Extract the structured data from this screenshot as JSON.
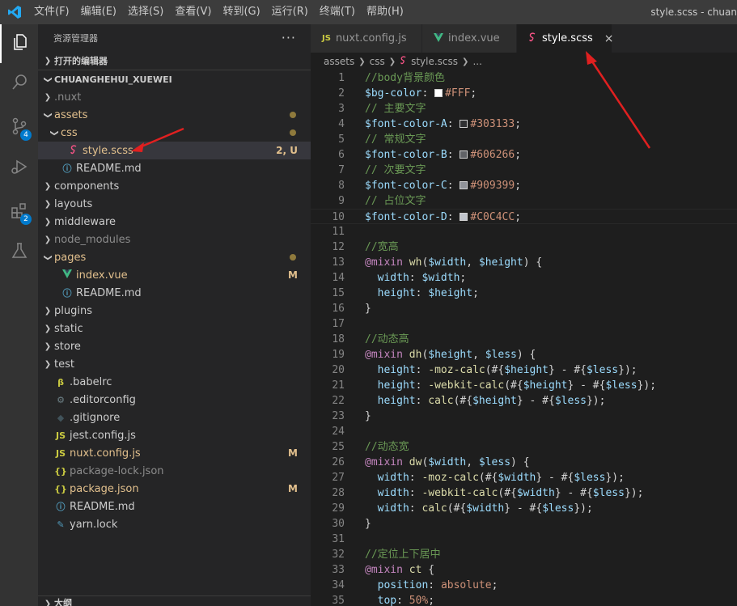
{
  "titlebar": {
    "menus": [
      "文件(F)",
      "编辑(E)",
      "选择(S)",
      "查看(V)",
      "转到(G)",
      "运行(R)",
      "终端(T)",
      "帮助(H)"
    ],
    "window_title": "style.scss - chuan"
  },
  "activity": {
    "scm_badge": "4",
    "ext_badge": "2"
  },
  "sidebar": {
    "title": "资源管理器",
    "more": "···",
    "open_editors": "打开的编辑器",
    "workspace": "CHUANGHEHUI_XUEWEI",
    "outline": "大纲",
    "tree": [
      {
        "label": ".nuxt",
        "kind": "folder",
        "state": "closed",
        "depth": 1,
        "muted": true
      },
      {
        "label": "assets",
        "kind": "folder",
        "state": "open",
        "depth": 1,
        "mod": true,
        "dot": true
      },
      {
        "label": "css",
        "kind": "folder",
        "state": "open",
        "depth": 2,
        "mod": true,
        "dot": true
      },
      {
        "label": "style.scss",
        "kind": "scss",
        "depth": 3,
        "mod": true,
        "status": "2, U",
        "selected": true
      },
      {
        "label": "README.md",
        "kind": "info",
        "depth": 2
      },
      {
        "label": "components",
        "kind": "folder",
        "state": "closed",
        "depth": 1
      },
      {
        "label": "layouts",
        "kind": "folder",
        "state": "closed",
        "depth": 1
      },
      {
        "label": "middleware",
        "kind": "folder",
        "state": "closed",
        "depth": 1
      },
      {
        "label": "node_modules",
        "kind": "folder",
        "state": "closed",
        "depth": 1,
        "muted": true
      },
      {
        "label": "pages",
        "kind": "folder",
        "state": "open",
        "depth": 1,
        "mod": true,
        "dot": true
      },
      {
        "label": "index.vue",
        "kind": "vue",
        "depth": 2,
        "mod": true,
        "status": "M"
      },
      {
        "label": "README.md",
        "kind": "info",
        "depth": 2
      },
      {
        "label": "plugins",
        "kind": "folder",
        "state": "closed",
        "depth": 1
      },
      {
        "label": "static",
        "kind": "folder",
        "state": "closed",
        "depth": 1
      },
      {
        "label": "store",
        "kind": "folder",
        "state": "closed",
        "depth": 1
      },
      {
        "label": "test",
        "kind": "folder",
        "state": "closed",
        "depth": 1
      },
      {
        "label": ".babelrc",
        "kind": "babel",
        "depth": 1
      },
      {
        "label": ".editorconfig",
        "kind": "gear",
        "depth": 1
      },
      {
        "label": ".gitignore",
        "kind": "git",
        "depth": 1
      },
      {
        "label": "jest.config.js",
        "kind": "js",
        "depth": 1
      },
      {
        "label": "nuxt.config.js",
        "kind": "js",
        "depth": 1,
        "mod": true,
        "status": "M"
      },
      {
        "label": "package-lock.json",
        "kind": "json",
        "depth": 1,
        "muted": true
      },
      {
        "label": "package.json",
        "kind": "json",
        "depth": 1,
        "mod": true,
        "status": "M"
      },
      {
        "label": "README.md",
        "kind": "info",
        "depth": 1
      },
      {
        "label": "yarn.lock",
        "kind": "yarn",
        "depth": 1
      }
    ]
  },
  "tabs": [
    {
      "label": "nuxt.config.js",
      "icon": "JS",
      "kind": "js",
      "active": false
    },
    {
      "label": "index.vue",
      "icon": "V",
      "kind": "vue",
      "active": false
    },
    {
      "label": "style.scss",
      "icon": "sass",
      "kind": "scss",
      "active": true,
      "close": "×"
    }
  ],
  "breadcrumb": [
    "assets",
    "css",
    "style.scss",
    "..."
  ],
  "colors": {
    "bg": "#FFF",
    "A": "#303133",
    "B": "#606266",
    "C": "#909399",
    "D": "#C0C4CC",
    "accent": "#007acc",
    "arrow": "#e02020"
  },
  "code": [
    [
      {
        "t": "//body背景颜色",
        "c": "cmt"
      }
    ],
    [
      {
        "t": "$bg-color",
        "c": "var"
      },
      {
        "t": ": ",
        "c": "p"
      },
      {
        "t": "#FFF",
        "c": "num",
        "sw": "#FFFFFF"
      },
      {
        "t": ";",
        "c": "p"
      }
    ],
    [
      {
        "t": "// 主要文字",
        "c": "cmt"
      }
    ],
    [
      {
        "t": "$font-color-A",
        "c": "var"
      },
      {
        "t": ": ",
        "c": "p"
      },
      {
        "t": "#303133",
        "c": "num",
        "sw": "#303133"
      },
      {
        "t": ";",
        "c": "p"
      }
    ],
    [
      {
        "t": "// 常规文字",
        "c": "cmt"
      }
    ],
    [
      {
        "t": "$font-color-B",
        "c": "var"
      },
      {
        "t": ": ",
        "c": "p"
      },
      {
        "t": "#606266",
        "c": "num",
        "sw": "#606266"
      },
      {
        "t": ";",
        "c": "p"
      }
    ],
    [
      {
        "t": "// 次要文字",
        "c": "cmt"
      }
    ],
    [
      {
        "t": "$font-color-C",
        "c": "var"
      },
      {
        "t": ": ",
        "c": "p"
      },
      {
        "t": "#909399",
        "c": "num",
        "sw": "#909399"
      },
      {
        "t": ";",
        "c": "p"
      }
    ],
    [
      {
        "t": "// 占位文字",
        "c": "cmt"
      }
    ],
    [
      {
        "t": "$font-color-D",
        "c": "var"
      },
      {
        "t": ": ",
        "c": "p"
      },
      {
        "t": "#C0C4CC",
        "c": "num",
        "sw": "#C0C4CC"
      },
      {
        "t": ";",
        "c": "p"
      }
    ],
    [],
    [
      {
        "t": "//宽高",
        "c": "cmt"
      }
    ],
    [
      {
        "t": "@mixin",
        "c": "kw"
      },
      {
        "t": " ",
        "c": "p"
      },
      {
        "t": "wh",
        "c": "fn"
      },
      {
        "t": "(",
        "c": "p"
      },
      {
        "t": "$width",
        "c": "var"
      },
      {
        "t": ", ",
        "c": "p"
      },
      {
        "t": "$height",
        "c": "var"
      },
      {
        "t": ") {",
        "c": "p"
      }
    ],
    [
      {
        "t": "  width",
        "c": "var"
      },
      {
        "t": ": ",
        "c": "p"
      },
      {
        "t": "$width",
        "c": "var"
      },
      {
        "t": ";",
        "c": "p"
      }
    ],
    [
      {
        "t": "  height",
        "c": "var"
      },
      {
        "t": ": ",
        "c": "p"
      },
      {
        "t": "$height",
        "c": "var"
      },
      {
        "t": ";",
        "c": "p"
      }
    ],
    [
      {
        "t": "}",
        "c": "p"
      }
    ],
    [],
    [
      {
        "t": "//动态高",
        "c": "cmt"
      }
    ],
    [
      {
        "t": "@mixin",
        "c": "kw"
      },
      {
        "t": " ",
        "c": "p"
      },
      {
        "t": "dh",
        "c": "fn"
      },
      {
        "t": "(",
        "c": "p"
      },
      {
        "t": "$height",
        "c": "var"
      },
      {
        "t": ", ",
        "c": "p"
      },
      {
        "t": "$less",
        "c": "var"
      },
      {
        "t": ") {",
        "c": "p"
      }
    ],
    [
      {
        "t": "  height",
        "c": "var"
      },
      {
        "t": ": ",
        "c": "p"
      },
      {
        "t": "-moz-calc",
        "c": "fn"
      },
      {
        "t": "(#{",
        "c": "p"
      },
      {
        "t": "$height",
        "c": "var"
      },
      {
        "t": "} - #{",
        "c": "p"
      },
      {
        "t": "$less",
        "c": "var"
      },
      {
        "t": "});",
        "c": "p"
      }
    ],
    [
      {
        "t": "  height",
        "c": "var"
      },
      {
        "t": ": ",
        "c": "p"
      },
      {
        "t": "-webkit-calc",
        "c": "fn"
      },
      {
        "t": "(#{",
        "c": "p"
      },
      {
        "t": "$height",
        "c": "var"
      },
      {
        "t": "} - #{",
        "c": "p"
      },
      {
        "t": "$less",
        "c": "var"
      },
      {
        "t": "});",
        "c": "p"
      }
    ],
    [
      {
        "t": "  height",
        "c": "var"
      },
      {
        "t": ": ",
        "c": "p"
      },
      {
        "t": "calc",
        "c": "fn"
      },
      {
        "t": "(#{",
        "c": "p"
      },
      {
        "t": "$height",
        "c": "var"
      },
      {
        "t": "} - #{",
        "c": "p"
      },
      {
        "t": "$less",
        "c": "var"
      },
      {
        "t": "});",
        "c": "p"
      }
    ],
    [
      {
        "t": "}",
        "c": "p"
      }
    ],
    [],
    [
      {
        "t": "//动态宽",
        "c": "cmt"
      }
    ],
    [
      {
        "t": "@mixin",
        "c": "kw"
      },
      {
        "t": " ",
        "c": "p"
      },
      {
        "t": "dw",
        "c": "fn"
      },
      {
        "t": "(",
        "c": "p"
      },
      {
        "t": "$width",
        "c": "var"
      },
      {
        "t": ", ",
        "c": "p"
      },
      {
        "t": "$less",
        "c": "var"
      },
      {
        "t": ") {",
        "c": "p"
      }
    ],
    [
      {
        "t": "  width",
        "c": "var"
      },
      {
        "t": ": ",
        "c": "p"
      },
      {
        "t": "-moz-calc",
        "c": "fn"
      },
      {
        "t": "(#{",
        "c": "p"
      },
      {
        "t": "$width",
        "c": "var"
      },
      {
        "t": "} - #{",
        "c": "p"
      },
      {
        "t": "$less",
        "c": "var"
      },
      {
        "t": "});",
        "c": "p"
      }
    ],
    [
      {
        "t": "  width",
        "c": "var"
      },
      {
        "t": ": ",
        "c": "p"
      },
      {
        "t": "-webkit-calc",
        "c": "fn"
      },
      {
        "t": "(#{",
        "c": "p"
      },
      {
        "t": "$width",
        "c": "var"
      },
      {
        "t": "} - #{",
        "c": "p"
      },
      {
        "t": "$less",
        "c": "var"
      },
      {
        "t": "});",
        "c": "p"
      }
    ],
    [
      {
        "t": "  width",
        "c": "var"
      },
      {
        "t": ": ",
        "c": "p"
      },
      {
        "t": "calc",
        "c": "fn"
      },
      {
        "t": "(#{",
        "c": "p"
      },
      {
        "t": "$width",
        "c": "var"
      },
      {
        "t": "} - #{",
        "c": "p"
      },
      {
        "t": "$less",
        "c": "var"
      },
      {
        "t": "});",
        "c": "p"
      }
    ],
    [
      {
        "t": "}",
        "c": "p"
      }
    ],
    [],
    [
      {
        "t": "//定位上下居中",
        "c": "cmt"
      }
    ],
    [
      {
        "t": "@mixin",
        "c": "kw"
      },
      {
        "t": " ",
        "c": "p"
      },
      {
        "t": "ct",
        "c": "fn"
      },
      {
        "t": " {",
        "c": "p"
      }
    ],
    [
      {
        "t": "  position",
        "c": "var"
      },
      {
        "t": ": ",
        "c": "p"
      },
      {
        "t": "absolute",
        "c": "str"
      },
      {
        "t": ";",
        "c": "p"
      }
    ],
    [
      {
        "t": "  top",
        "c": "var"
      },
      {
        "t": ": ",
        "c": "p"
      },
      {
        "t": "50%",
        "c": "num"
      },
      {
        "t": ";",
        "c": "p"
      }
    ]
  ],
  "current_line": 10
}
